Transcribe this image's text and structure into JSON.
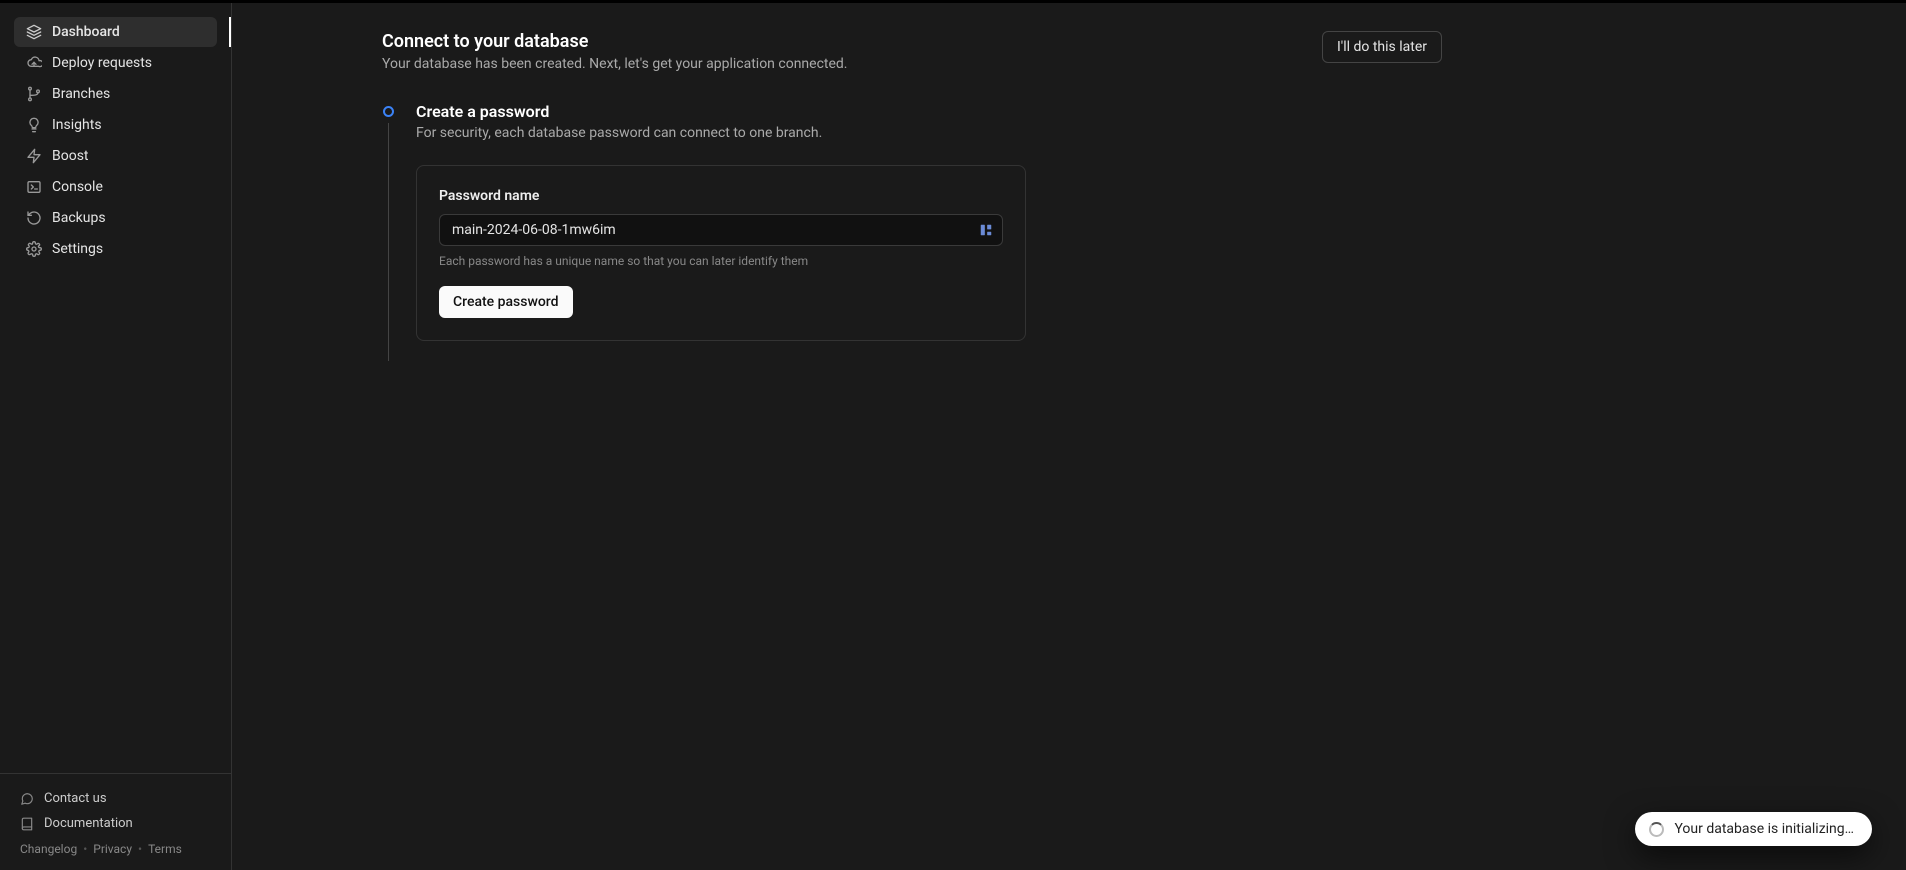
{
  "sidebar": {
    "items": [
      {
        "label": "Dashboard",
        "icon": "layers-icon",
        "active": true
      },
      {
        "label": "Deploy requests",
        "icon": "upload-cloud-icon",
        "active": false
      },
      {
        "label": "Branches",
        "icon": "git-branch-icon",
        "active": false
      },
      {
        "label": "Insights",
        "icon": "lightbulb-icon",
        "active": false
      },
      {
        "label": "Boost",
        "icon": "zap-icon",
        "active": false
      },
      {
        "label": "Console",
        "icon": "terminal-icon",
        "active": false
      },
      {
        "label": "Backups",
        "icon": "rewind-icon",
        "active": false
      },
      {
        "label": "Settings",
        "icon": "gear-icon",
        "active": false
      }
    ],
    "footer": {
      "contact": "Contact us",
      "documentation": "Documentation",
      "links": [
        "Changelog",
        "Privacy",
        "Terms"
      ]
    }
  },
  "header": {
    "title": "Connect to your database",
    "subtitle": "Your database has been created. Next, let's get your application connected.",
    "later_button": "I'll do this later"
  },
  "step": {
    "title": "Create a password",
    "desc": "For security, each database password can connect to one branch."
  },
  "form": {
    "label": "Password name",
    "value": "main-2024-06-08-1mw6im",
    "help": "Each password has a unique name so that you can later identify them",
    "submit": "Create password"
  },
  "toast": {
    "text": "Your database is initializing…"
  }
}
